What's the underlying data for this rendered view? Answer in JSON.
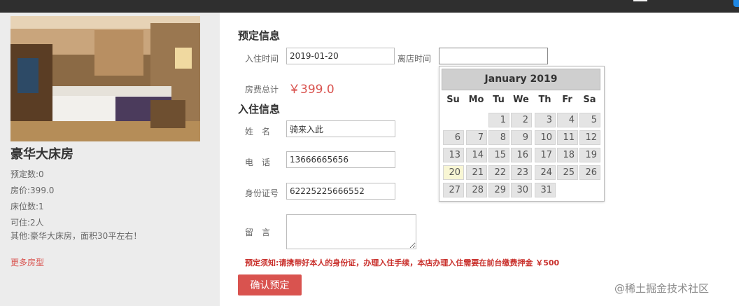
{
  "room": {
    "title": "豪华大床房",
    "details": [
      "预定数:0",
      "房价:399.0",
      "床位数:1",
      "可住:2人",
      "其他:豪华大床房，面积30平左右！"
    ],
    "more_link": "更多房型"
  },
  "booking": {
    "section_title": "预定信息",
    "checkin_label": "入住时间",
    "checkin_value": "2019-01-20",
    "checkout_label": "离店时间",
    "checkout_value": "",
    "total_label": "房费总计",
    "total_value": "￥399.0"
  },
  "guest": {
    "section_title": "入住信息",
    "name_label": "姓　名",
    "name_value": "骑来入此",
    "phone_label": "电　话",
    "phone_value": "13666665656",
    "id_label": "身份证号",
    "id_value": "62225225666552",
    "message_label": "留　言",
    "message_value": ""
  },
  "notice": "预定须知:请携带好本人的身份证，办理入住手续，本店办理入住需要在前台缴费押金 ￥500",
  "confirm_button": "确认预定",
  "calendar": {
    "month_label": "January 2019",
    "weekdays": [
      "Su",
      "Mo",
      "Tu",
      "We",
      "Th",
      "Fr",
      "Sa"
    ],
    "first_weekday": 2,
    "days_in_month": 31,
    "highlight_day": 20
  },
  "watermark": "@稀土掘金技术社区",
  "colors": {
    "accent": "#d9534f",
    "top_bar": "#2f2f2f",
    "left_panel": "#ececec"
  }
}
